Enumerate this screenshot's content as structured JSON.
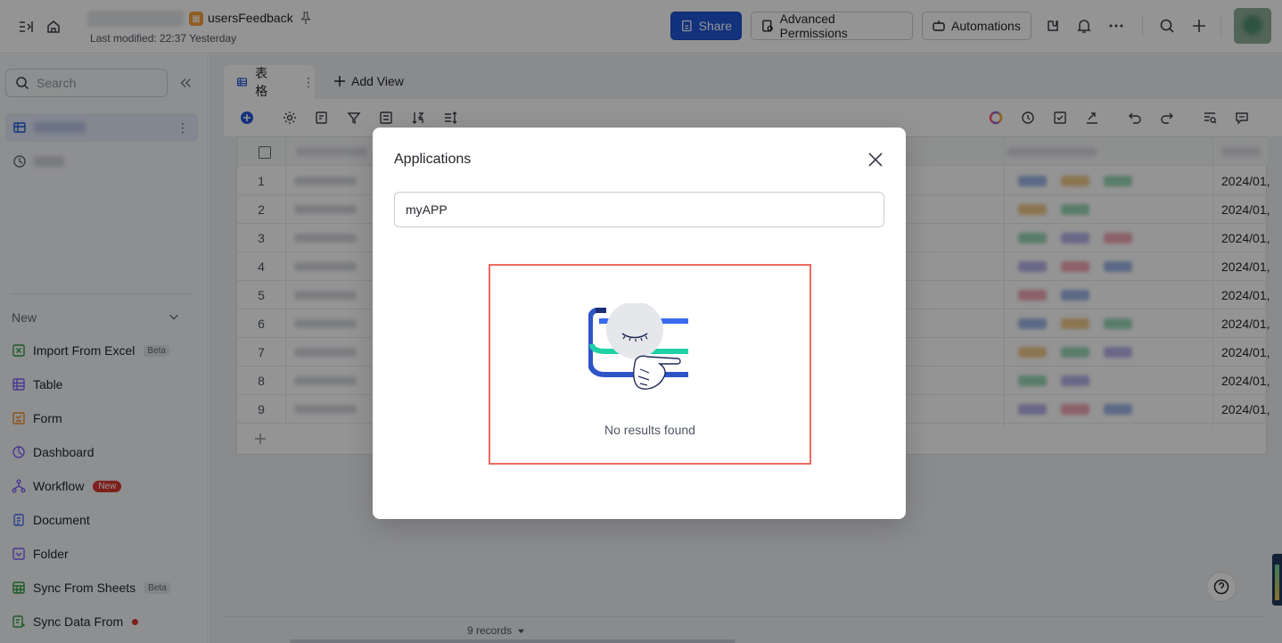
{
  "header": {
    "doc_title": "usersFeedback",
    "last_modified": "Last modified: 22:37 Yesterday",
    "share_label": "Share",
    "advanced_permissions_label": "Advanced Permissions",
    "automations_label": "Automations"
  },
  "sidebar": {
    "search_placeholder": "Search",
    "new_section_label": "New",
    "new_items": [
      {
        "label": "Import From Excel",
        "badge": "Beta",
        "icon": "excel-icon",
        "color": "#2f9e44"
      },
      {
        "label": "Table",
        "icon": "table-icon",
        "color": "#7b61ff"
      },
      {
        "label": "Form",
        "icon": "form-icon",
        "color": "#f08c2b"
      },
      {
        "label": "Dashboard",
        "icon": "dashboard-icon",
        "color": "#7b61ff"
      },
      {
        "label": "Workflow",
        "badge": "New",
        "icon": "workflow-icon",
        "color": "#7b61ff"
      },
      {
        "label": "Document",
        "icon": "document-icon",
        "color": "#4c6ef5"
      },
      {
        "label": "Folder",
        "icon": "folder-icon",
        "color": "#7b61ff"
      },
      {
        "label": "Sync From Sheets",
        "badge": "Beta",
        "icon": "sheets-icon",
        "color": "#2f9e44"
      },
      {
        "label": "Sync Data From",
        "icon": "sync-data-icon",
        "color": "#2f9e44"
      }
    ]
  },
  "main": {
    "view_tab_label": "表格",
    "add_view_label": "Add View",
    "row_numbers": [
      "1",
      "2",
      "3",
      "4",
      "5",
      "6",
      "7",
      "8",
      "9"
    ],
    "date_value": "2024/01,",
    "records_label": "9 records"
  },
  "modal": {
    "title": "Applications",
    "search_value": "myAPP",
    "empty_text": "No results found"
  },
  "colors": {
    "primary": "#2156d8",
    "highlight_border": "#ec6b5e",
    "accent_green": "#1fd1a5"
  }
}
